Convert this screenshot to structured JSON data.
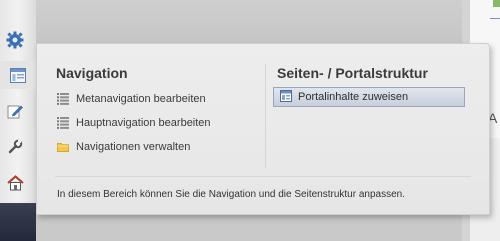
{
  "panel": {
    "navigation": {
      "title": "Navigation",
      "items": [
        {
          "label": "Metanavigation bearbeiten",
          "icon": "list-icon"
        },
        {
          "label": "Hauptnavigation bearbeiten",
          "icon": "list-icon"
        },
        {
          "label": "Navigationen verwalten",
          "icon": "folder-icon"
        }
      ]
    },
    "structure": {
      "title": "Seiten- / Portalstruktur",
      "items": [
        {
          "label": "Portalinhalte zuweisen",
          "icon": "page-layout-icon"
        }
      ]
    },
    "footer": "In diesem Bereich können Sie die Navigation und die Seitenstruktur anpassen."
  },
  "toolbar": {
    "icons": [
      "gear-icon",
      "structure-icon",
      "edit-icon",
      "wrench-icon",
      "home-icon"
    ]
  },
  "right_edge": {
    "letter": "A"
  },
  "colors": {
    "panel_bg": "#ececec",
    "title_text": "#3b3b3b",
    "button_highlight": "#c8cfdc",
    "folder": "#f2c94c",
    "gear_blue": "#3a6fb6"
  }
}
